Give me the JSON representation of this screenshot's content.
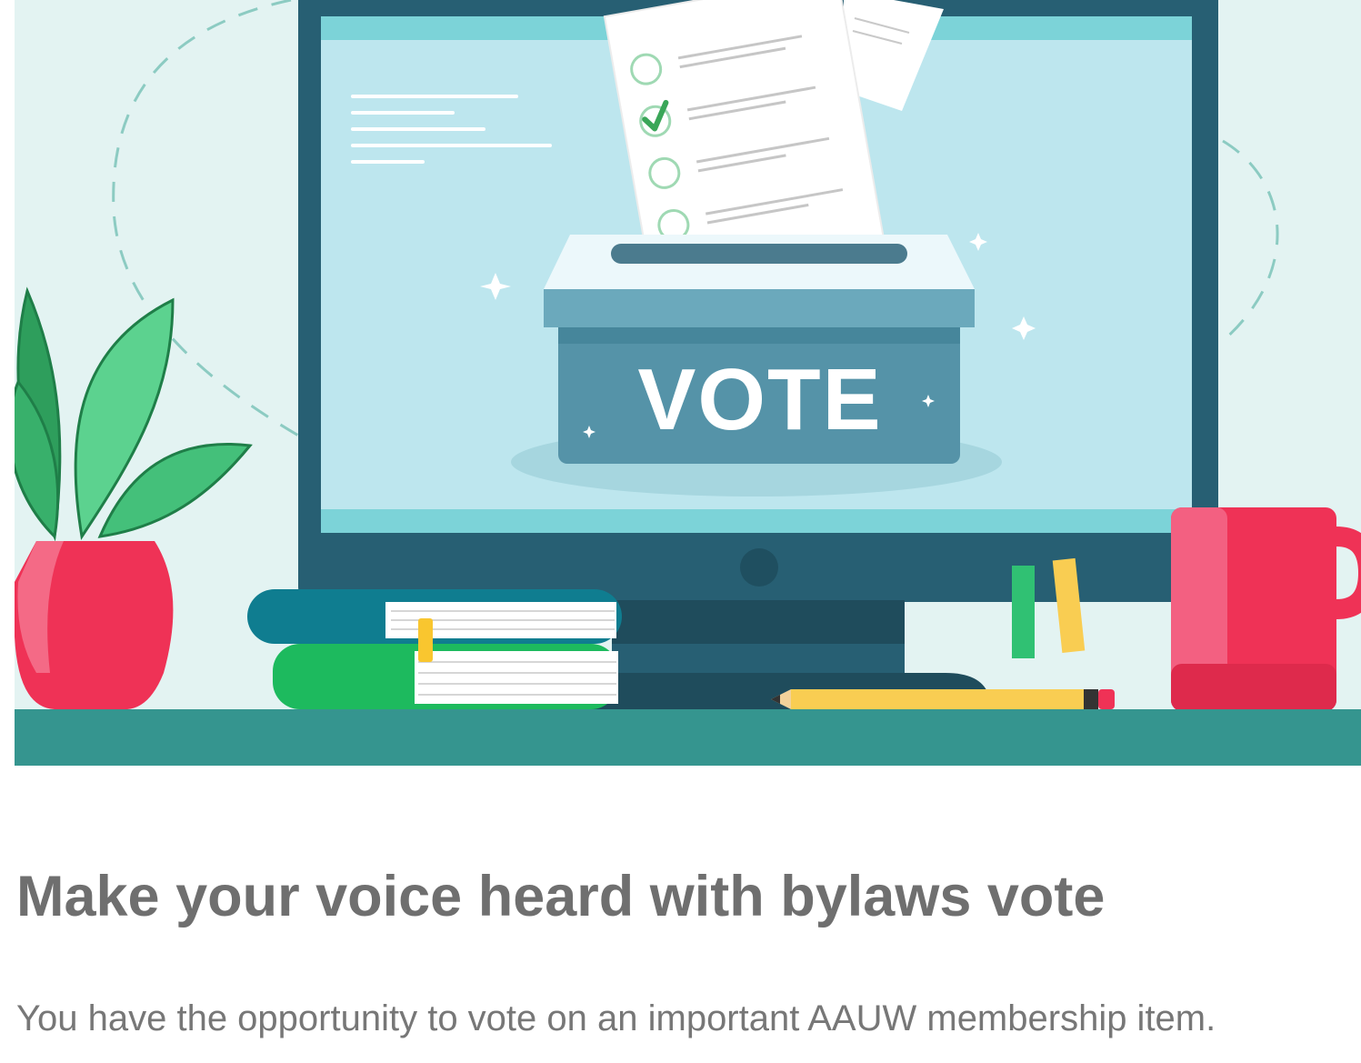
{
  "hero": {
    "ballot_box_label": "VOTE"
  },
  "article": {
    "headline": "Make your voice heard with bylaws vote",
    "body": "You have the opportunity to vote on an important AAUW membership item."
  },
  "colors": {
    "background_mint": "#e3f3f2",
    "monitor_frame": "#275f73",
    "screen": "#bde6ee",
    "ballot_box": "#5593a8",
    "shelf": "#35958f",
    "mug_red": "#ef3256",
    "leaf_green": "#3dbf72",
    "pencil_yellow": "#f9cd52",
    "heading_gray": "#6f6f6f",
    "body_gray": "#777777"
  }
}
